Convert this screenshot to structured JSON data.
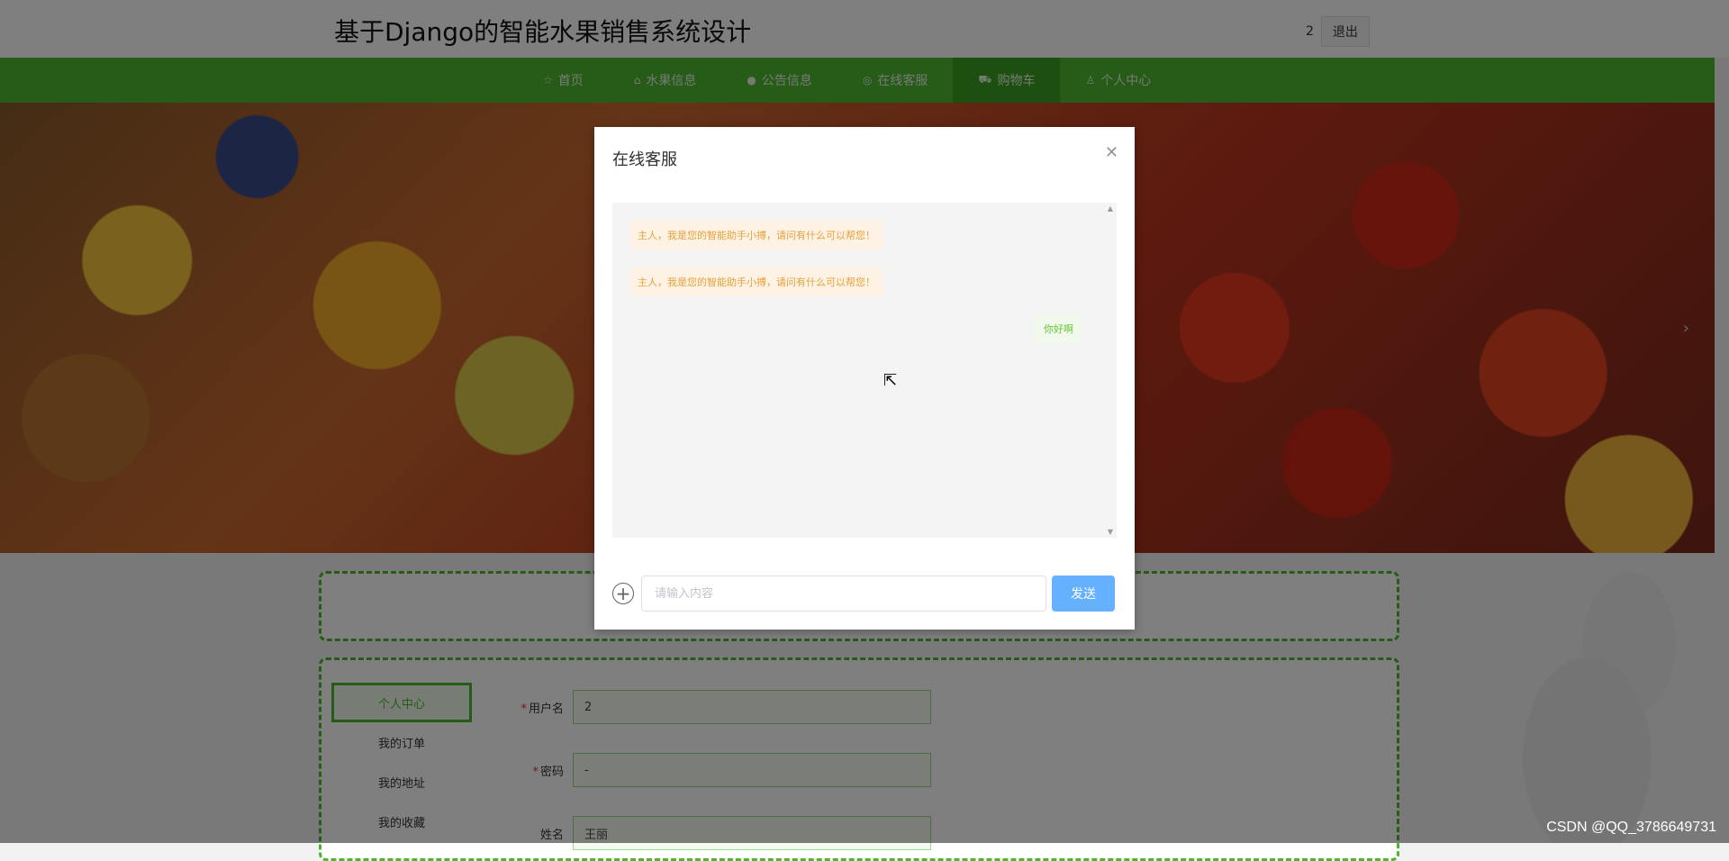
{
  "header": {
    "title": "基于Django的智能水果销售系统设计",
    "user_id": "2",
    "logout_label": "退出"
  },
  "nav": {
    "items": [
      {
        "label": "首页",
        "icon": "star-icon"
      },
      {
        "label": "水果信息",
        "icon": "bag-icon"
      },
      {
        "label": "公告信息",
        "icon": "info-icon"
      },
      {
        "label": "在线客服",
        "icon": "headset-icon"
      },
      {
        "label": "购物车",
        "icon": "cart-icon"
      },
      {
        "label": "个人中心",
        "icon": "user-icon"
      }
    ],
    "active_index": 4
  },
  "sidebar": {
    "items": [
      {
        "label": "个人中心"
      },
      {
        "label": "我的订单"
      },
      {
        "label": "我的地址"
      },
      {
        "label": "我的收藏"
      }
    ]
  },
  "form": {
    "username_label": "用户名",
    "username_value": "2",
    "password_label": "密码",
    "password_value": "-",
    "name_label": "姓名",
    "name_value": "王丽"
  },
  "modal": {
    "title": "在线客服",
    "messages": [
      {
        "side": "left",
        "text": "主人，我是您的智能助手小搏，请问有什么可以帮您！"
      },
      {
        "side": "left",
        "text": "主人，我是您的智能助手小搏，请问有什么可以帮您！"
      },
      {
        "side": "right",
        "text": "你好啊"
      }
    ],
    "input_placeholder": "请输入内容",
    "send_label": "发送"
  },
  "watermark": "CSDN @QQ_3786649731"
}
